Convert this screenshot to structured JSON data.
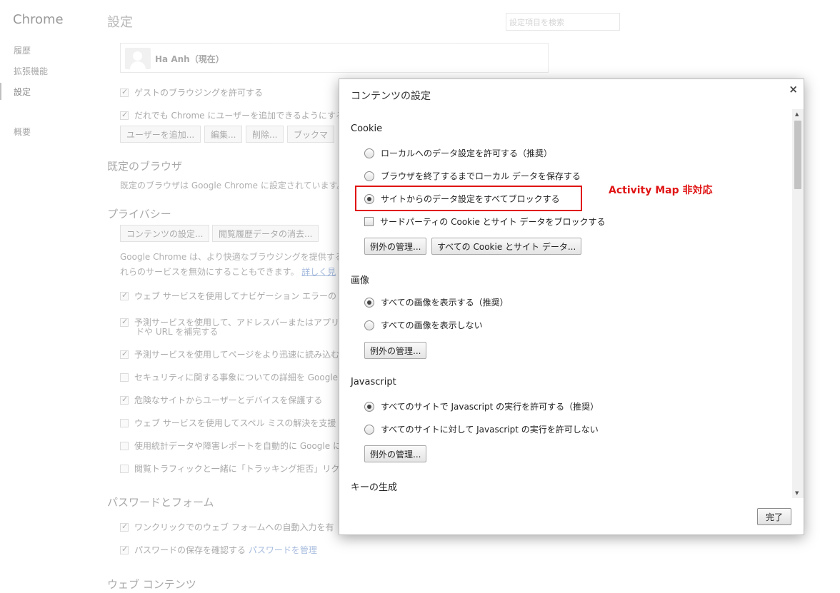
{
  "nav": {
    "title": "Chrome",
    "items": [
      "履歴",
      "拡張機能",
      "設定",
      "概要"
    ]
  },
  "page": {
    "title": "設定",
    "search_placeholder": "設定項目を検索",
    "user_name": "Ha Anh（現在）",
    "guest_browsing": "ゲストのブラウジングを許可する",
    "anyone_add_user": "だれでも Chrome にユーザーを追加できるようにする",
    "user_buttons": [
      "ユーザーを追加...",
      "編集...",
      "削除...",
      "ブックマ"
    ],
    "default_browser_heading": "既定のブラウザ",
    "default_browser_text": "既定のブラウザは Google Chrome に設定されています。",
    "privacy_heading": "プライバシー",
    "privacy_buttons": [
      "コンテンツの設定...",
      "閲覧履歴データの消去..."
    ],
    "privacy_text_1": "Google Chrome は、より快適なブラウジングを提供する",
    "privacy_text_2": "れらのサービスを無効にすることもできます。",
    "privacy_link": "詳しく見",
    "privacy_checks": [
      {
        "label": "ウェブ サービスを使用してナビゲーション エラーの",
        "checked": true
      },
      {
        "label": "予測サービスを使用して、アドレスバーまたはアプリ",
        "checked": true
      },
      {
        "label": "ドや URL を補完する",
        "checked": false
      },
      {
        "label": "予測サービスを使用してページをより迅速に読み込む",
        "checked": true
      },
      {
        "label": "セキュリティに関する事象についての詳細を Google",
        "checked": false
      },
      {
        "label": "危険なサイトからユーザーとデバイスを保護する",
        "checked": true
      },
      {
        "label": "ウェブ サービスを使用してスペル ミスの解決を支援",
        "checked": false
      },
      {
        "label": "使用統計データや障害レポートを自動的に Google に",
        "checked": false
      },
      {
        "label": "閲覧トラフィックと一緒に「トラッキング拒否」リク",
        "checked": false
      }
    ],
    "password_heading": "パスワードとフォーム",
    "autofill": "ワンクリックでのウェブ フォームへの自動入力を有",
    "password_save": "パスワードの保存を確認する",
    "password_link": "パスワードを管理",
    "web_content_heading": "ウェブ コンテンツ"
  },
  "dialog": {
    "title": "コンテンツの設定",
    "close_glyph": "×",
    "cookie": {
      "heading": "Cookie",
      "options": [
        {
          "label": "ローカルへのデータ設定を許可する（推奨）",
          "selected": false
        },
        {
          "label": "ブラウザを終了するまでローカル データを保存する",
          "selected": false
        },
        {
          "label": "サイトからのデータ設定をすべてブロックする",
          "selected": true
        }
      ],
      "third_party": "サードパーティの Cookie とサイト データをブロックする",
      "exceptions_button": "例外の管理...",
      "all_cookies_button": "すべての Cookie とサイト データ..."
    },
    "annotation": "Activity Map 非対応",
    "images": {
      "heading": "画像",
      "options": [
        {
          "label": "すべての画像を表示する（推奨）",
          "selected": true
        },
        {
          "label": "すべての画像を表示しない",
          "selected": false
        }
      ],
      "exceptions_button": "例外の管理..."
    },
    "javascript": {
      "heading": "Javascript",
      "options": [
        {
          "label": "すべてのサイトで Javascript の実行を許可する（推奨）",
          "selected": true
        },
        {
          "label": "すべてのサイトに対して Javascript の実行を許可しない",
          "selected": false
        }
      ],
      "exceptions_button": "例外の管理..."
    },
    "keygen_heading": "キーの生成",
    "done_button": "完了"
  },
  "colors": {
    "highlight": "#e01414",
    "link": "#2a5db0"
  }
}
